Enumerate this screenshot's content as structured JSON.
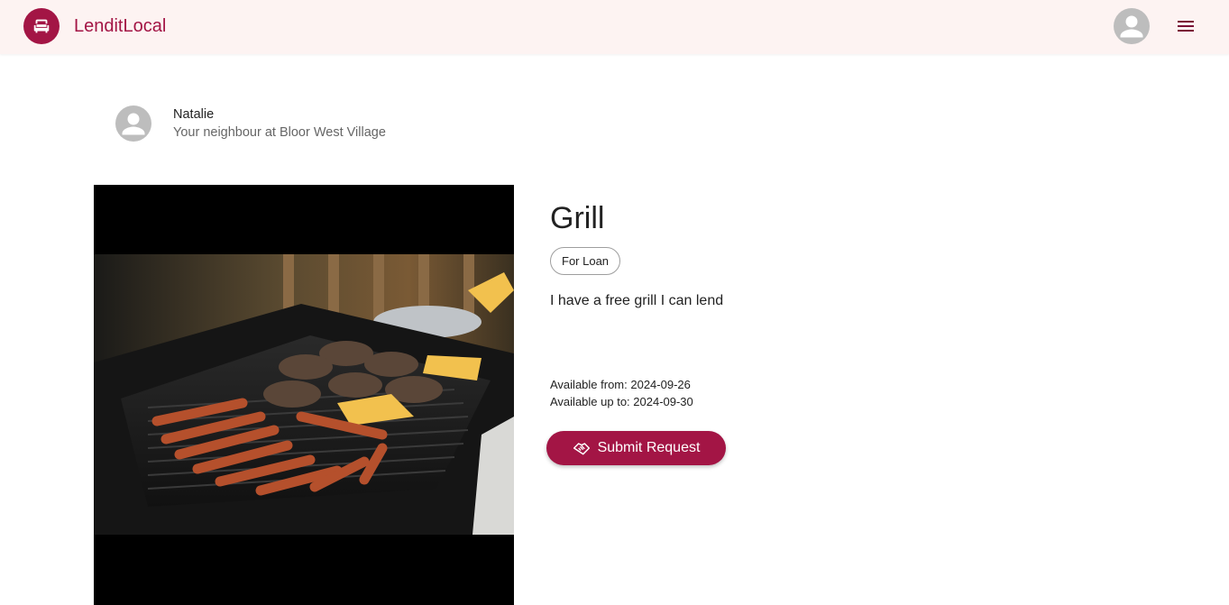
{
  "header": {
    "app_title": "LenditLocal",
    "logo_icon": "sofa-icon",
    "profile_icon": "person-icon",
    "menu_icon": "hamburger-menu-icon"
  },
  "owner": {
    "name": "Natalie",
    "subtitle": "Your neighbour at Bloor West Village",
    "avatar_icon": "person-icon"
  },
  "item": {
    "title": "Grill",
    "tag": "For Loan",
    "description": "I have a free grill I can lend",
    "available_from": "Available from: 2024-09-26",
    "available_to": "Available up to: 2024-09-30",
    "image_subject": "grill with burgers and hot dogs"
  },
  "actions": {
    "submit_label": "Submit Request",
    "submit_icon": "handshake-icon"
  },
  "colors": {
    "brand": "#a31545",
    "header_bg": "#fdf3f2",
    "avatar_grey": "#bdbdbd"
  }
}
